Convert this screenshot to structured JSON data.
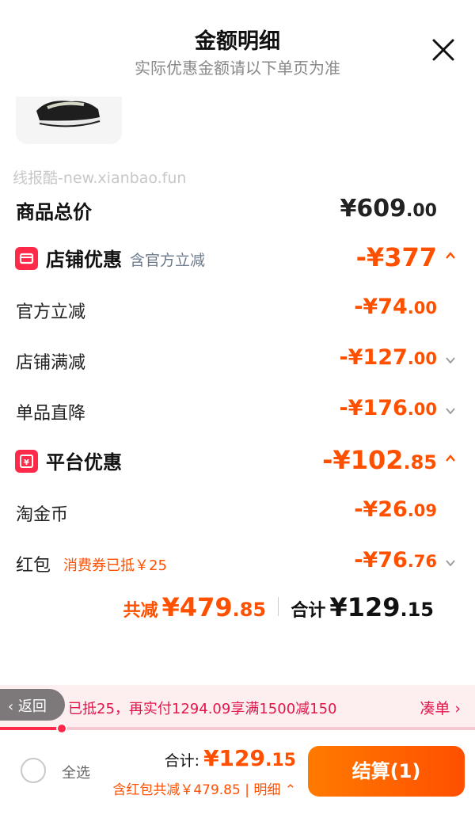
{
  "header": {
    "title": "金额明细",
    "subtitle": "实际优惠金额请以下单页为准"
  },
  "watermark": "线报酷-new.xianbao.fun",
  "colors": {
    "accent": "#ff5000",
    "badge": "#ff2a4a",
    "promo": "#e0174a"
  },
  "total": {
    "label": "商品总价",
    "int": "¥609",
    "dec": ".00"
  },
  "store_discount": {
    "label": "店铺优惠",
    "note": "含官方立减",
    "int": "-¥377",
    "dec": "",
    "icon": "store-badge-icon",
    "items": [
      {
        "label": "官方立减",
        "int": "-¥74",
        "dec": ".00"
      },
      {
        "label": "店铺满减",
        "int": "-¥127",
        "dec": ".00"
      },
      {
        "label": "单品直降",
        "int": "-¥176",
        "dec": ".00"
      }
    ]
  },
  "platform_discount": {
    "label": "平台优惠",
    "int": "-¥102",
    "dec": ".85",
    "icon": "platform-badge-icon",
    "items": [
      {
        "label": "淘金币",
        "int": "-¥26",
        "dec": ".09"
      },
      {
        "label": "红包",
        "note": "消费券已抵￥25",
        "int": "-¥76",
        "dec": ".76"
      }
    ]
  },
  "summary": {
    "reduce_label": "共减",
    "reduce_int": "¥479",
    "reduce_dec": ".85",
    "total_label": "合计",
    "total_int": "¥129",
    "total_dec": ".15"
  },
  "promo": {
    "back_label": "返回",
    "text": "已抵25，再实付1294.09享满1500减150",
    "link": "凑单 ›",
    "progress": 0.13
  },
  "footer": {
    "select_all": "全选",
    "total_label": "合计:",
    "total_int": "¥129",
    "total_dec": ".15",
    "sub": "含红包共减￥479.85 | 明细 ⌃",
    "checkout": "结算(1)"
  }
}
